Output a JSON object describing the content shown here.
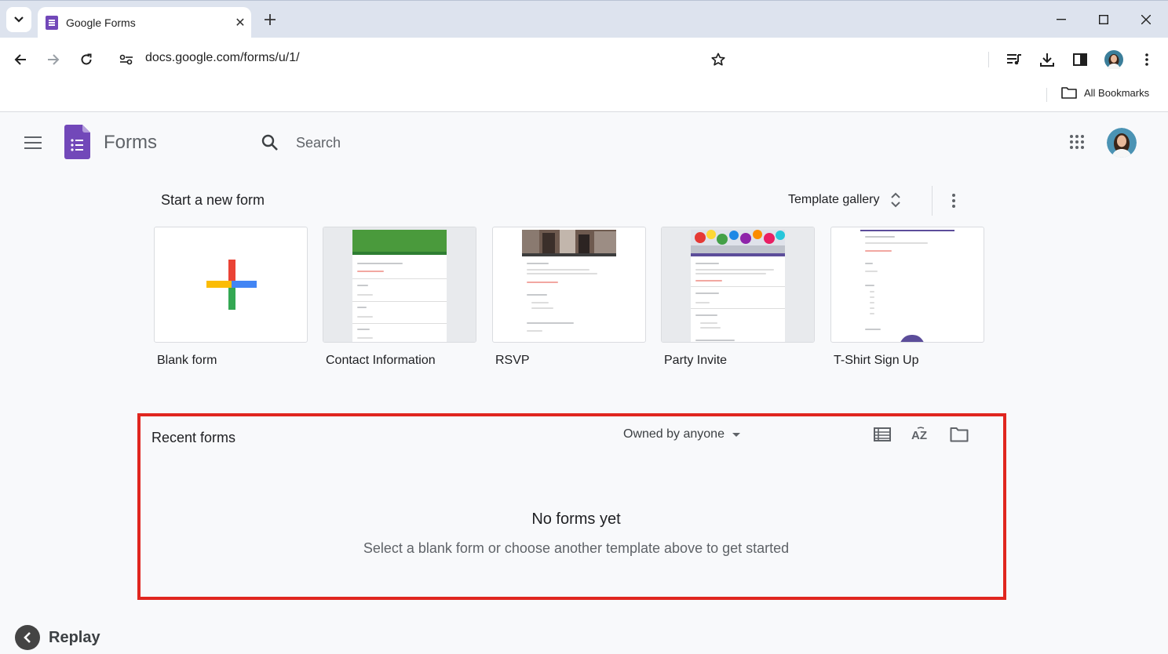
{
  "browser": {
    "tab_title": "Google Forms",
    "url": "docs.google.com/forms/u/1/",
    "bookmarks_label": "All Bookmarks"
  },
  "app": {
    "name": "Forms",
    "search_placeholder": "Search"
  },
  "start": {
    "title": "Start a new form",
    "gallery_label": "Template gallery",
    "templates": [
      {
        "label": "Blank form"
      },
      {
        "label": "Contact Information"
      },
      {
        "label": "RSVP"
      },
      {
        "label": "Party Invite"
      },
      {
        "label": "T-Shirt Sign Up"
      }
    ]
  },
  "recent": {
    "title": "Recent forms",
    "owner_filter": "Owned by anyone",
    "empty_title": "No forms yet",
    "empty_subtitle": "Select a blank form or choose another template above to get started"
  },
  "replay_label": "Replay",
  "colors": {
    "forms_purple": "#7248b9",
    "highlight_border": "#e0261f",
    "tabstrip": "#dde3ee"
  }
}
